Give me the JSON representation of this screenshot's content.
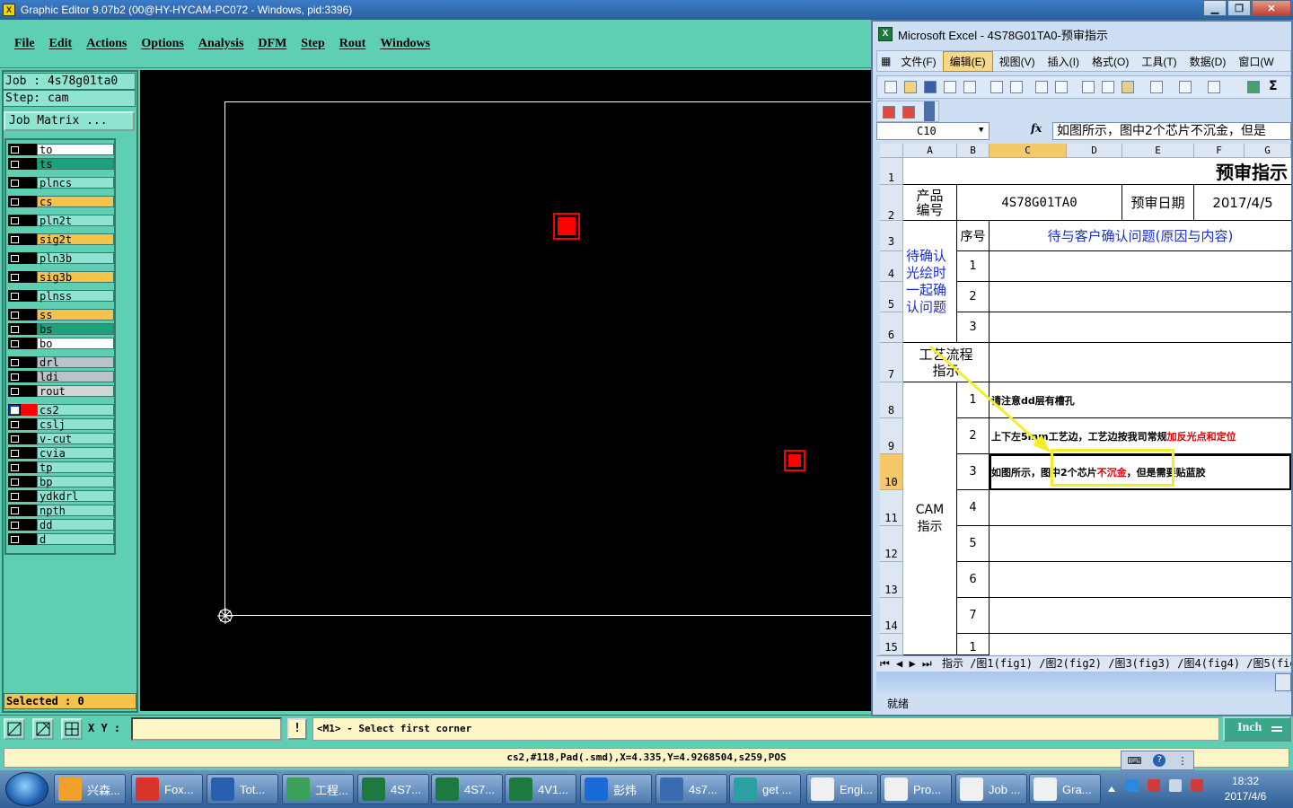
{
  "window": {
    "title": "Graphic Editor 9.07b2 (00@HY-HYCAM-PC072 - Windows, pid:3396)"
  },
  "menu": [
    "File",
    "Edit",
    "Actions",
    "Options",
    "Analysis",
    "DFM",
    "Step",
    "Rout",
    "Windows"
  ],
  "job": {
    "job_line": "Job : 4s78g01ta0",
    "step_line": "Step: cam",
    "matrix_label": "Job Matrix ..."
  },
  "layers": [
    {
      "name": "to",
      "color": "#ffffff"
    },
    {
      "name": "ts",
      "color": "#1aa37a"
    },
    {
      "name": "plncs",
      "color": "#8fe4cf"
    },
    {
      "name": "cs",
      "color": "#f8c14a"
    },
    {
      "name": "pln2t",
      "color": "#8fe4cf"
    },
    {
      "name": "sig2t",
      "color": "#f8c14a"
    },
    {
      "name": "pln3b",
      "color": "#8fe4cf"
    },
    {
      "name": "sig3b",
      "color": "#f8c14a"
    },
    {
      "name": "plnss",
      "color": "#8fe4cf"
    },
    {
      "name": "ss",
      "color": "#f8c14a"
    },
    {
      "name": "bs",
      "color": "#1aa37a"
    },
    {
      "name": "bo",
      "color": "#ffffff"
    },
    {
      "name": "drl",
      "color": "#b9c3c8"
    },
    {
      "name": "ldi",
      "color": "#b9c3c8"
    },
    {
      "name": "rout",
      "color": "#d0d6d8"
    },
    {
      "name": "cs2",
      "color": "#8fe4cf"
    },
    {
      "name": "cslj",
      "color": "#8fe4cf"
    },
    {
      "name": "v-cut",
      "color": "#8fe4cf"
    },
    {
      "name": "cvia",
      "color": "#8fe4cf"
    },
    {
      "name": "tp",
      "color": "#8fe4cf"
    },
    {
      "name": "bp",
      "color": "#8fe4cf"
    },
    {
      "name": "ydkdrl",
      "color": "#8fe4cf"
    },
    {
      "name": "npth",
      "color": "#8fe4cf"
    },
    {
      "name": "dd",
      "color": "#8fe4cf"
    },
    {
      "name": "d",
      "color": "#8fe4cf"
    }
  ],
  "selected": "Selected : 0",
  "cmd": {
    "xy_label": "X Y :",
    "xy_value": "",
    "excl": "!",
    "prompt": "<M1> - Select first corner",
    "unit": "Inch"
  },
  "status": "cs2,#118,Pad(.smd),X=4.335,Y=4.9268504,s259,POS",
  "excel": {
    "title": "Microsoft Excel - 4S78G01TA0-预审指示",
    "menu": [
      "文件(F)",
      "编辑(E)",
      "视图(V)",
      "插入(I)",
      "格式(O)",
      "工具(T)",
      "数据(D)",
      "窗口(W"
    ],
    "namebox": "C10",
    "fx": "fx",
    "formula": "如图所示，图中2个芯片不沉金，但是",
    "columns": [
      "A",
      "B",
      "C",
      "D",
      "E",
      "F",
      "G"
    ],
    "rows": [
      "1",
      "2",
      "3",
      "4",
      "5",
      "6",
      "7",
      "8",
      "9",
      "10",
      "11",
      "12",
      "13",
      "14",
      "15"
    ],
    "title_cell": "预审指示",
    "product_label": "产品编号",
    "product_no": "4S78G01TA0",
    "date_label": "预审日期",
    "date": "2017/4/5",
    "pending_label": "待确认光绘时一起确认问题",
    "seq_label": "序号",
    "pending_header": "待与客户确认问题(原因与内容)",
    "process_label": "工艺流程指示",
    "cam_label": "CAM指示",
    "seq": [
      "1",
      "2",
      "3",
      "1",
      "2",
      "3",
      "4",
      "5",
      "6",
      "7",
      "1"
    ],
    "item1": "请注意dd层有槽孔",
    "item2_a": "上下左5mm工艺边，工艺边按我司常规",
    "item2_b": "加反光点和定位",
    "item3_a": "如图所示，",
    "item3_b": "图中2个芯片",
    "item3_c": "不沉金",
    "item3_d": "，但是需要贴蓝胶",
    "sheet_tabs": "指示 /图1(fig1) /图2(fig2) /图3(fig3) /图4(fig4) /图5(fig",
    "status": "就绪"
  },
  "taskbar": {
    "items": [
      "兴森...",
      "Fox...",
      "Tot...",
      "工程...",
      "4S7...",
      "4S7...",
      "4V1...",
      "彭炜",
      "4s7...",
      "get ...",
      "Engi...",
      "Pro...",
      "Job ...",
      "Gra..."
    ],
    "time": "18:32",
    "date": "2017/4/6"
  }
}
